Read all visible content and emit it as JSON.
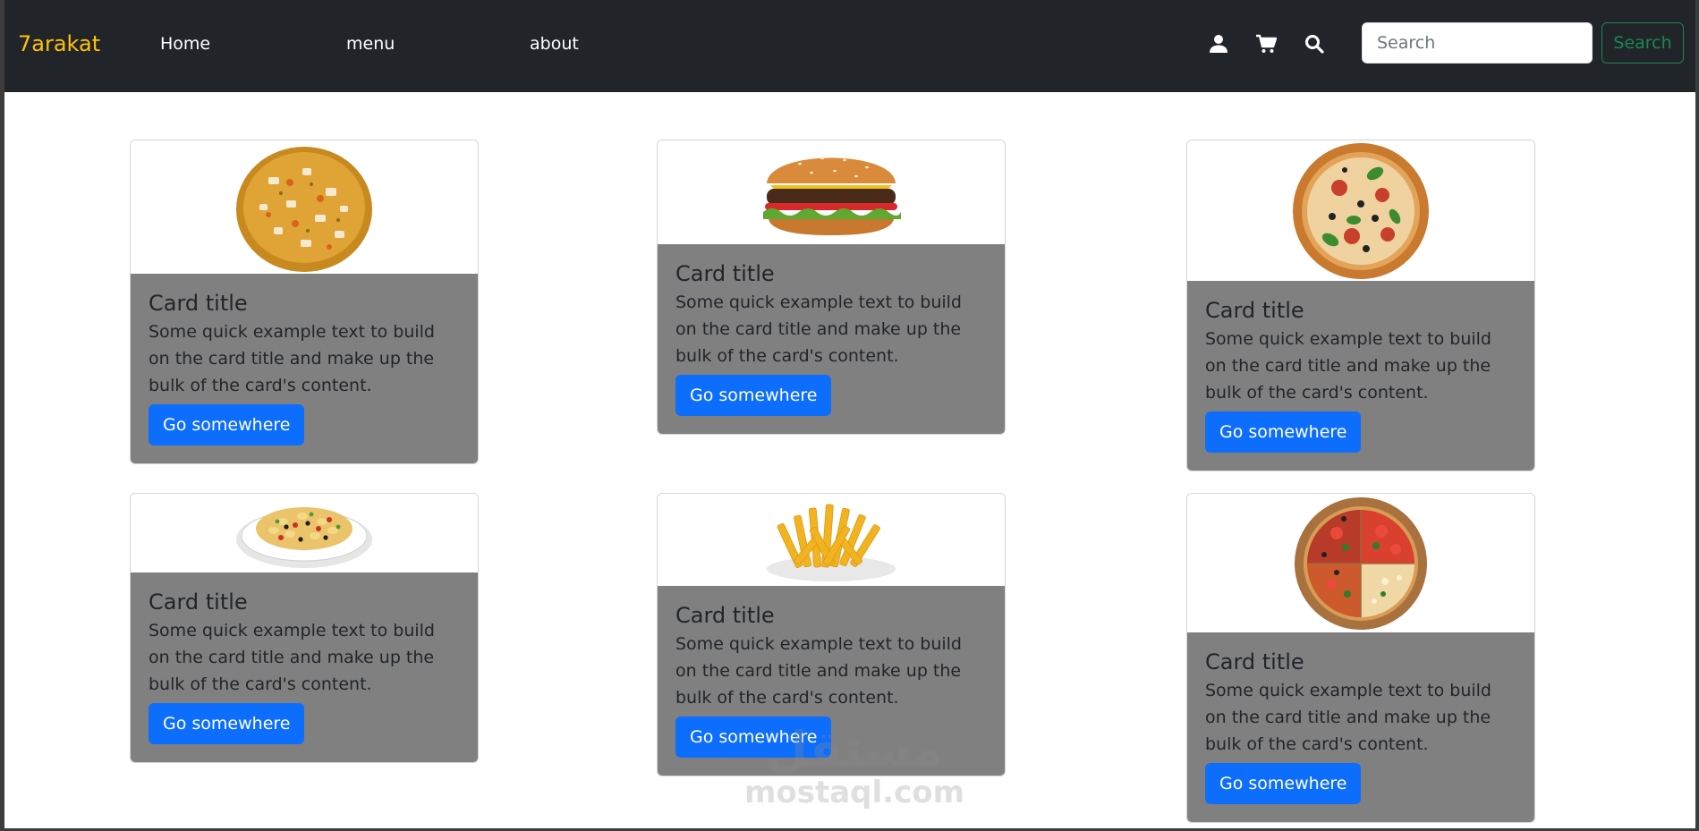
{
  "navbar": {
    "brand": "7arakat",
    "links": [
      "Home",
      "menu",
      "about"
    ],
    "icons": [
      "user-icon",
      "cart-icon",
      "search-icon"
    ],
    "search": {
      "placeholder": "Search",
      "value": "",
      "button_label": "Search"
    },
    "colors": {
      "background": "#212529",
      "brand": "#ffc107",
      "search_button": "#198754"
    }
  },
  "cards": [
    {
      "image": "pizza-onion-image",
      "title": "Card title",
      "text": "Some quick example text to build on the card title and make up the bulk of the card's content.",
      "button": "Go somewhere"
    },
    {
      "image": "burger-image",
      "title": "Card title",
      "text": "Some quick example text to build on the card title and make up the bulk of the card's content.",
      "button": "Go somewhere"
    },
    {
      "image": "pizza-basil-image",
      "title": "Card title",
      "text": "Some quick example text to build on the card title and make up the bulk of the card's content.",
      "button": "Go somewhere"
    },
    {
      "image": "pasta-salad-image",
      "title": "Card title",
      "text": "Some quick example text to build on the card title and make up the bulk of the card's content.",
      "button": "Go somewhere"
    },
    {
      "image": "french-fries-image",
      "title": "Card title",
      "text": "Some quick example text to build on the card title and make up the bulk of the card's content.",
      "button": "Go somewhere"
    },
    {
      "image": "pizza-mixed-image",
      "title": "Card title",
      "text": "Some quick example text to build on the card title and make up the bulk of the card's content.",
      "button": "Go somewhere"
    }
  ],
  "card_colors": {
    "body_background": "#808080",
    "button": "#0d6efd"
  },
  "watermark": {
    "arabic": "مستقل",
    "latin": "mostaql.com"
  }
}
